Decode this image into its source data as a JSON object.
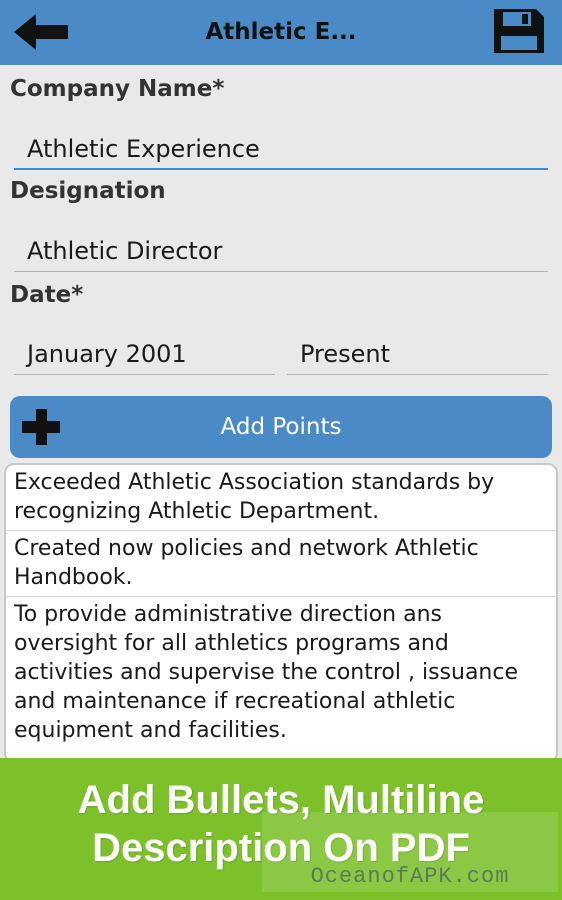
{
  "header": {
    "title": "Athletic E...",
    "back_icon": "arrow-left-icon",
    "save_icon": "floppy-disk-icon"
  },
  "form": {
    "company_label": "Company Name",
    "company_required": "*",
    "company_value": "Athletic Experience",
    "designation_label": "Designation",
    "designation_value": "Athletic Director",
    "date_label": "Date",
    "date_required": "*",
    "start_date": "January 2001",
    "end_date": "Present"
  },
  "add_points": {
    "label": "Add Points",
    "icon": "plus-icon"
  },
  "points": [
    "Exceeded Athletic Association standards by recognizing Athletic Department.",
    "Created now policies and network Athletic Handbook.",
    "To provide administrative direction ans oversight for all athletics programs and activities and supervise the control , issuance and maintenance if recreational athletic equipment and facilities."
  ],
  "banner": {
    "line1": "Add Bullets, Multiline",
    "line2": "Description On PDF",
    "watermark": "OceanofAPK.com"
  },
  "colors": {
    "header_bg": "#4a8bc7",
    "banner_bg": "#7cc129",
    "active_underline": "#3b8fd6"
  }
}
